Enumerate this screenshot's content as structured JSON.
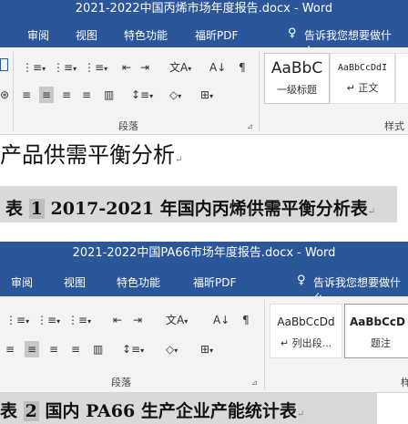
{
  "top": {
    "title": "2021-2022中国丙烯市场年度报告.docx - Word",
    "menu": [
      "审阅",
      "视图",
      "特色功能",
      "福昕PDF"
    ],
    "tell_me": "告诉我您想要做什么...",
    "group_paragraph": "段落",
    "group_styles": "样式",
    "styles": [
      {
        "sample": "AaBbC",
        "name": "一级标题"
      },
      {
        "sample": "AaBbCcDdI",
        "name": "↵ 正文"
      }
    ],
    "heading": "产品供需平衡分析",
    "caption_prefix": "表",
    "caption_num": "1",
    "caption_text": "2017-2021 年国内丙烯供需平衡分析表"
  },
  "bottom": {
    "title": "2021-2022中国PA66市场年度报告.docx - Word",
    "menu": [
      "审阅",
      "视图",
      "特色功能",
      "福昕PDF"
    ],
    "tell_me": "告诉我您想要做什么",
    "group_paragraph": "段落",
    "group_styles": "样",
    "styles": [
      {
        "sample": "AaBbCcDd",
        "name": "↵ 列出段..."
      },
      {
        "sample": "AaBbCcD",
        "name": "题注"
      }
    ],
    "caption_prefix": "表",
    "caption_num": "2",
    "caption_text": "国内 PA66 生产企业产能统计表"
  },
  "icons": {
    "bullets": "⋮≡",
    "numbering": "⋮≡",
    "multilevel": "⋮≡",
    "decrease_indent": "⇤",
    "increase_indent": "⇥",
    "chinese_layout": "文A",
    "sort": "A↓",
    "show_marks": "¶",
    "align_left": "≡",
    "align_center": "≡",
    "align_right": "≡",
    "justify": "≡",
    "distributed": "▥",
    "line_spacing": "↕≡",
    "shading": "◇",
    "borders": "⊞",
    "lightbulb": "♀",
    "paragraph_mark": "↵",
    "dropdown": "▾"
  }
}
